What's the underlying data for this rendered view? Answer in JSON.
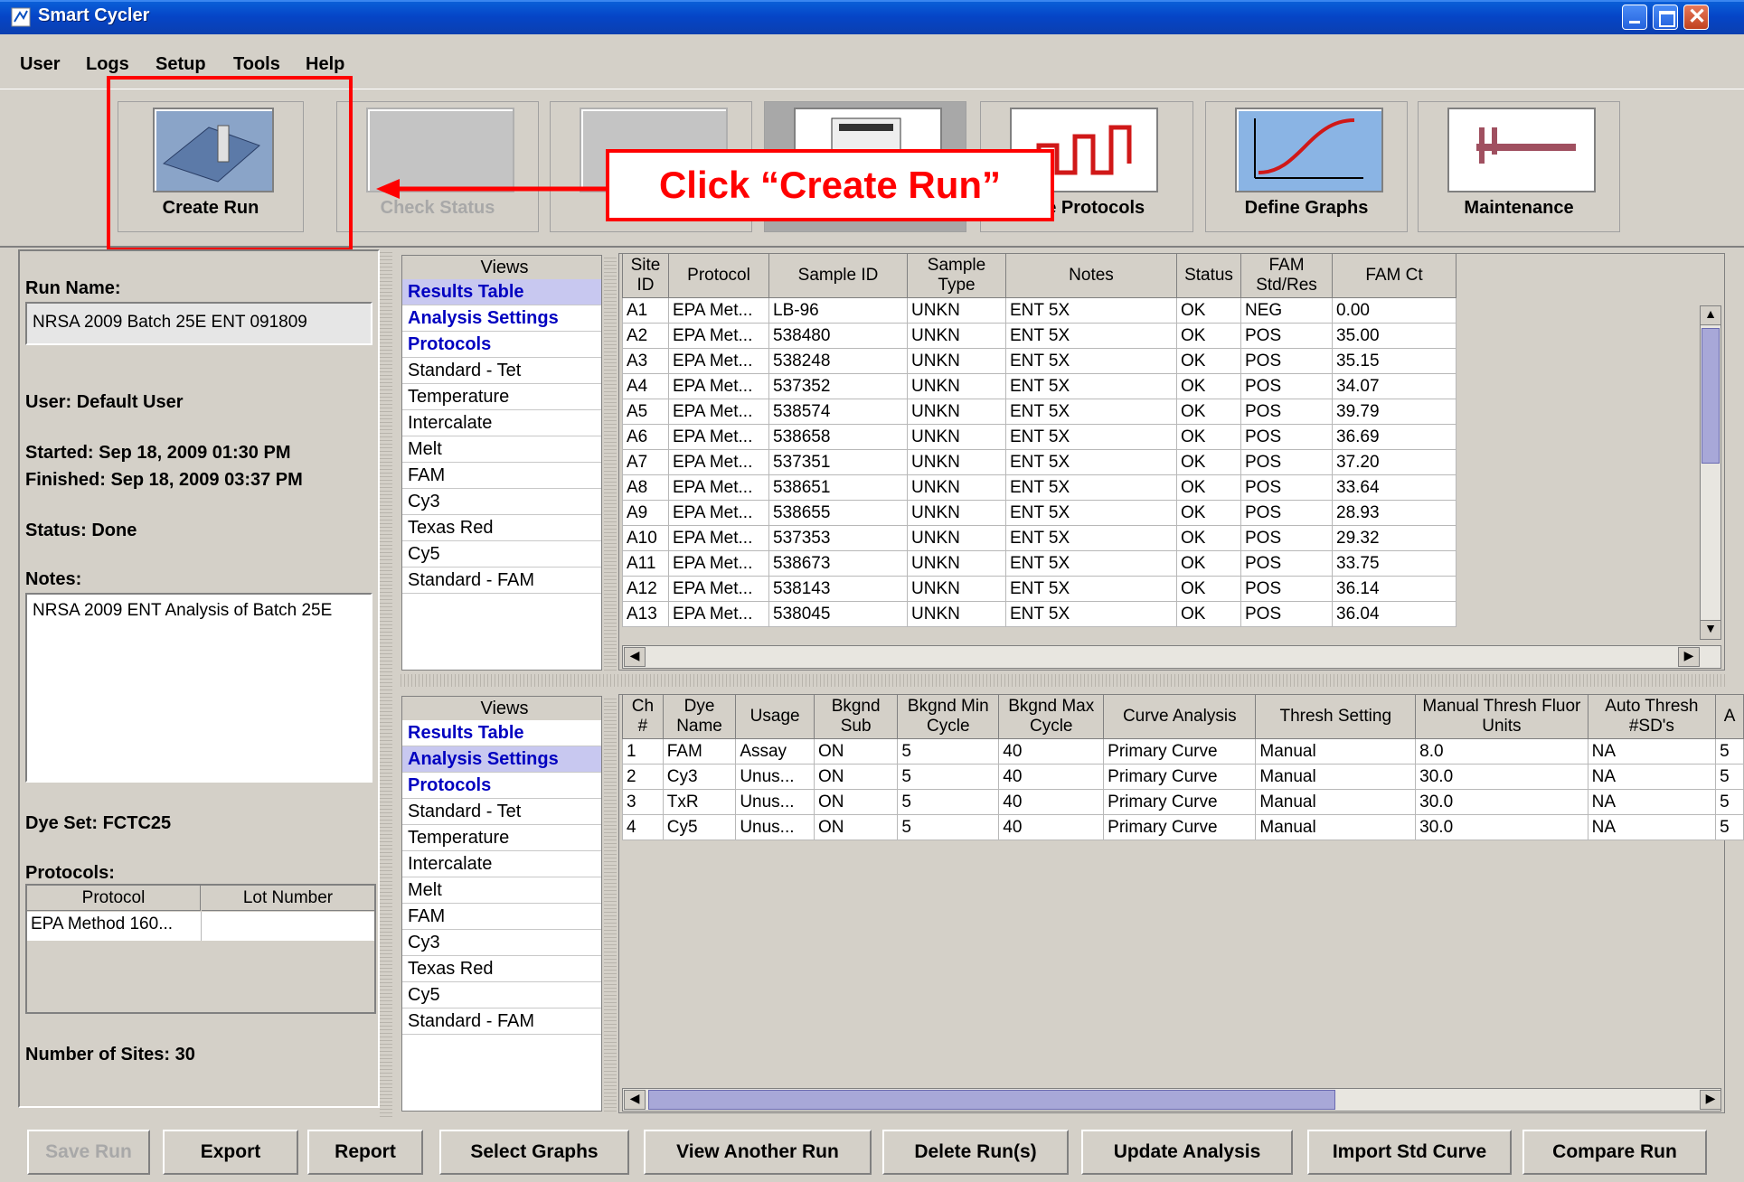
{
  "window": {
    "title": "Smart Cycler"
  },
  "menu": [
    "User",
    "Logs",
    "Setup",
    "Tools",
    "Help"
  ],
  "toolbar": [
    {
      "label": "Create Run",
      "icon": "create-run-icon"
    },
    {
      "label": "Check Status",
      "icon": "check-status-icon"
    },
    {
      "label": "",
      "icon": "view-results-icon"
    },
    {
      "label": "",
      "icon": "device-icon"
    },
    {
      "label": "ne Protocols",
      "icon": "protocols-icon"
    },
    {
      "label": "Define Graphs",
      "icon": "graph-icon"
    },
    {
      "label": "Maintenance",
      "icon": "caliper-icon"
    }
  ],
  "annotation": {
    "callout": "Click “Create Run”"
  },
  "left": {
    "run_name_label": "Run Name:",
    "run_name": "NRSA 2009 Batch 25E ENT 091809",
    "user": "User: Default User",
    "started": "Started: Sep 18, 2009 01:30 PM",
    "finished": "Finished: Sep 18, 2009 03:37 PM",
    "status": "Status: Done",
    "notes_label": "Notes:",
    "notes": "NRSA 2009 ENT Analysis of Batch 25E",
    "dye_set": "Dye Set: FCTC25",
    "protocols_label": "Protocols:",
    "protocol_header": "Protocol",
    "lot_header": "Lot Number",
    "protocol_value": "EPA Method 160...",
    "sites": "Number of Sites: 30"
  },
  "views": {
    "header": "Views",
    "items": [
      "Results Table",
      "Analysis Settings",
      "Protocols",
      "Standard - Tet",
      "Temperature",
      "Intercalate",
      "Melt",
      "FAM",
      "Cy3",
      "Texas Red",
      "Cy5",
      "Standard - FAM"
    ]
  },
  "results": {
    "headers": [
      "Site ID",
      "Protocol",
      "Sample ID",
      "Sample Type",
      "Notes",
      "Status",
      "FAM Std/Res",
      "FAM Ct"
    ],
    "rows": [
      [
        "A1",
        "EPA Met...",
        "LB-96",
        "UNKN",
        "ENT 5X",
        "OK",
        "NEG",
        "0.00"
      ],
      [
        "A2",
        "EPA Met...",
        "538480",
        "UNKN",
        "ENT 5X",
        "OK",
        "POS",
        "35.00"
      ],
      [
        "A3",
        "EPA Met...",
        "538248",
        "UNKN",
        "ENT 5X",
        "OK",
        "POS",
        "35.15"
      ],
      [
        "A4",
        "EPA Met...",
        "537352",
        "UNKN",
        "ENT 5X",
        "OK",
        "POS",
        "34.07"
      ],
      [
        "A5",
        "EPA Met...",
        "538574",
        "UNKN",
        "ENT 5X",
        "OK",
        "POS",
        "39.79"
      ],
      [
        "A6",
        "EPA Met...",
        "538658",
        "UNKN",
        "ENT 5X",
        "OK",
        "POS",
        "36.69"
      ],
      [
        "A7",
        "EPA Met...",
        "537351",
        "UNKN",
        "ENT 5X",
        "OK",
        "POS",
        "37.20"
      ],
      [
        "A8",
        "EPA Met...",
        "538651",
        "UNKN",
        "ENT 5X",
        "OK",
        "POS",
        "33.64"
      ],
      [
        "A9",
        "EPA Met...",
        "538655",
        "UNKN",
        "ENT 5X",
        "OK",
        "POS",
        "28.93"
      ],
      [
        "A10",
        "EPA Met...",
        "537353",
        "UNKN",
        "ENT 5X",
        "OK",
        "POS",
        "29.32"
      ],
      [
        "A11",
        "EPA Met...",
        "538673",
        "UNKN",
        "ENT 5X",
        "OK",
        "POS",
        "33.75"
      ],
      [
        "A12",
        "EPA Met...",
        "538143",
        "UNKN",
        "ENT 5X",
        "OK",
        "POS",
        "36.14"
      ],
      [
        "A13",
        "EPA Met...",
        "538045",
        "UNKN",
        "ENT 5X",
        "OK",
        "POS",
        "36.04"
      ]
    ]
  },
  "analysis": {
    "headers": [
      "Ch #",
      "Dye Name",
      "Usage",
      "Bkgnd Sub",
      "Bkgnd Min Cycle",
      "Bkgnd Max Cycle",
      "Curve Analysis",
      "Thresh Setting",
      "Manual Thresh Fluor Units",
      "Auto Thresh #SD's",
      "A"
    ],
    "rows": [
      [
        "1",
        "FAM",
        "Assay",
        "ON",
        "5",
        "40",
        "Primary Curve",
        "Manual",
        "8.0",
        "NA",
        "5"
      ],
      [
        "2",
        "Cy3",
        "Unus...",
        "ON",
        "5",
        "40",
        "Primary Curve",
        "Manual",
        "30.0",
        "NA",
        "5"
      ],
      [
        "3",
        "TxR",
        "Unus...",
        "ON",
        "5",
        "40",
        "Primary Curve",
        "Manual",
        "30.0",
        "NA",
        "5"
      ],
      [
        "4",
        "Cy5",
        "Unus...",
        "ON",
        "5",
        "40",
        "Primary Curve",
        "Manual",
        "30.0",
        "NA",
        "5"
      ]
    ]
  },
  "buttons": [
    "Save Run",
    "Export",
    "Report",
    "Select Graphs",
    "View Another Run",
    "Delete Run(s)",
    "Update Analysis",
    "Import Std Curve",
    "Compare Run"
  ]
}
